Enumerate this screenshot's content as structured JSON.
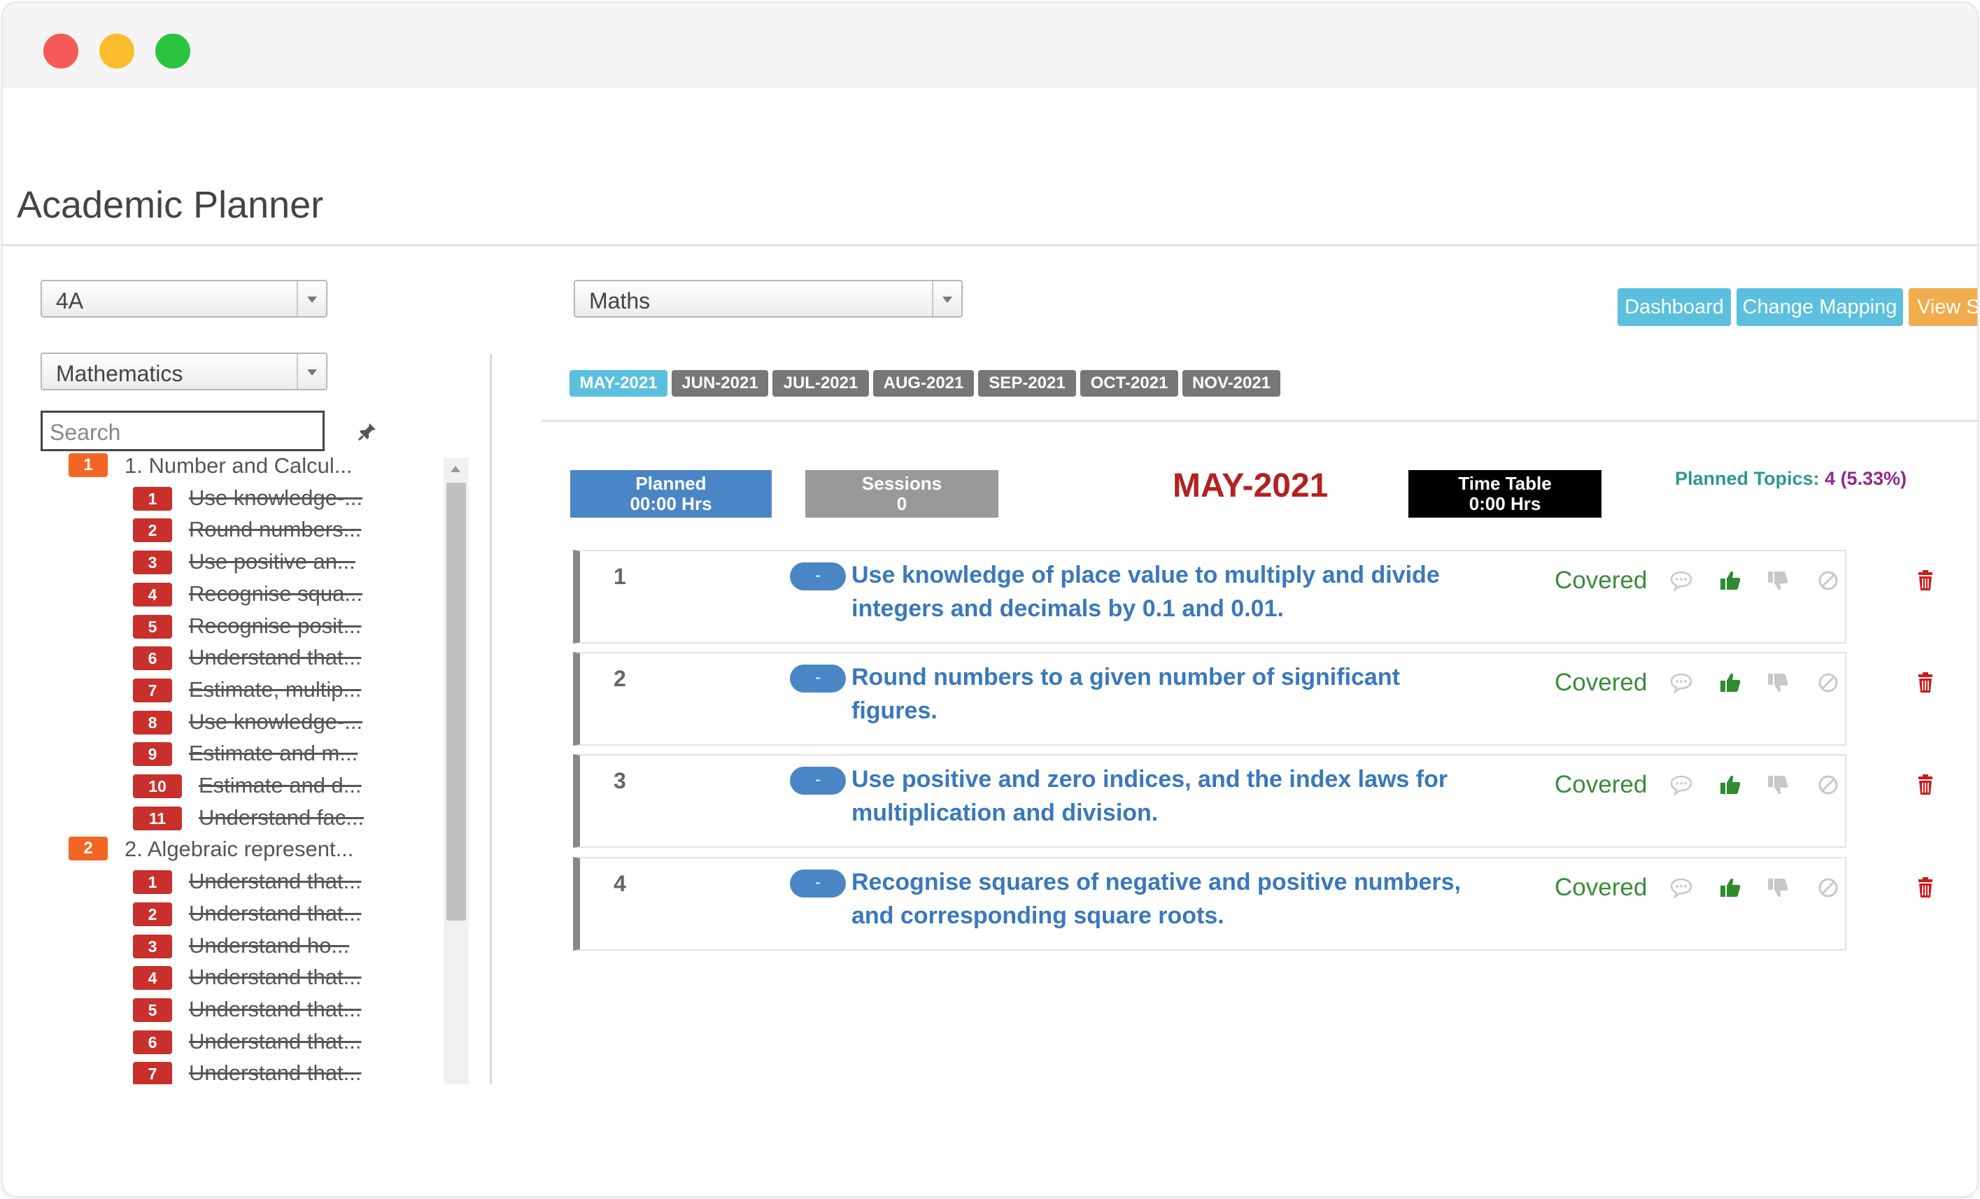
{
  "page_title": "Academic Planner",
  "filters": {
    "class": "4A",
    "subject": "Mathematics",
    "course": "Maths",
    "search_placeholder": "Search"
  },
  "buttons": {
    "dashboard": "Dashboard",
    "change_mapping": "Change Mapping",
    "view": "View S"
  },
  "months": [
    "MAY-2021",
    "JUN-2021",
    "JUL-2021",
    "AUG-2021",
    "SEP-2021",
    "OCT-2021",
    "NOV-2021"
  ],
  "active_month": "MAY-2021",
  "stats": {
    "planned_label": "Planned",
    "planned_value": "00:00 Hrs",
    "sessions_label": "Sessions",
    "sessions_value": "0",
    "month_heading": "MAY-2021",
    "timetable_label": "Time Table",
    "timetable_value": "0:00 Hrs",
    "planned_topics_label": "Planned Topics:",
    "planned_topics_value": "4 (5.33%)"
  },
  "tree": {
    "chapters": [
      {
        "badge": "1",
        "label": "1. Number and Calcul...",
        "topics": [
          {
            "badge": "1",
            "label": "Use knowledge-..."
          },
          {
            "badge": "2",
            "label": "Round numbers..."
          },
          {
            "badge": "3",
            "label": "Use positive an..."
          },
          {
            "badge": "4",
            "label": "Recognise squa..."
          },
          {
            "badge": "5",
            "label": "Recognise posit..."
          },
          {
            "badge": "6",
            "label": "Understand that..."
          },
          {
            "badge": "7",
            "label": "Estimate, multip..."
          },
          {
            "badge": "8",
            "label": "Use knowledge-..."
          },
          {
            "badge": "9",
            "label": "Estimate and m..."
          },
          {
            "badge": "10",
            "label": "Estimate and d..."
          },
          {
            "badge": "11",
            "label": "Understand fac..."
          }
        ]
      },
      {
        "badge": "2",
        "label": "2. Algebraic represent...",
        "topics": [
          {
            "badge": "1",
            "label": "Understand that..."
          },
          {
            "badge": "2",
            "label": "Understand that..."
          },
          {
            "badge": "3",
            "label": "Understand ho..."
          },
          {
            "badge": "4",
            "label": "Understand that..."
          },
          {
            "badge": "5",
            "label": "Understand that..."
          },
          {
            "badge": "6",
            "label": "Understand that..."
          },
          {
            "badge": "7",
            "label": "Understand that..."
          }
        ]
      }
    ]
  },
  "topics": [
    {
      "num": "1",
      "toggle": "-",
      "text": "Use knowledge of place value to multiply and divide integers and decimals by 0.1 and 0.01.",
      "status": "Covered"
    },
    {
      "num": "2",
      "toggle": "-",
      "text": "Round numbers to a given number of significant figures.",
      "status": "Covered"
    },
    {
      "num": "3",
      "toggle": "-",
      "text": "Use positive and zero indices, and the index laws for multiplication and division.",
      "status": "Covered"
    },
    {
      "num": "4",
      "toggle": "-",
      "text": "Recognise squares of negative and positive numbers, and corresponding square roots.",
      "status": "Covered"
    }
  ],
  "colors": {
    "accent_blue": "#4a86c5",
    "info_blue": "#5bc0de",
    "covered_green": "#3b8a3b",
    "month_red": "#b22222",
    "badge_red": "#c9302c",
    "badge_orange": "#f26522"
  }
}
